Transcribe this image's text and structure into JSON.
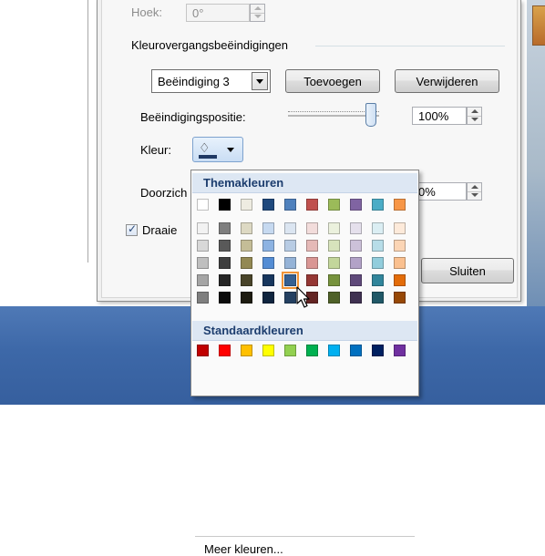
{
  "dialog": {
    "hoek_label": "Hoek:",
    "hoek_value": "0°",
    "section_title": "Kleurovergangsbeëindigingen",
    "stop_select_value": "Beëindiging 3",
    "add_label": "Toevoegen",
    "remove_label": "Verwijderen",
    "position_label": "Beëindigingspositie:",
    "position_value": "100%",
    "position_slider_fraction": 1.0,
    "color_label": "Kleur:",
    "transparency_label_visible": "Doorzich",
    "transparency_value": "0%",
    "rotate_checkbox_label_visible": "Draaie",
    "rotate_checked": true,
    "close_label": "Sluiten"
  },
  "palette": {
    "theme_header": "Themakleuren",
    "standard_header": "Standaardkleuren",
    "more_colors": "Meer kleuren...",
    "theme_columns": [
      [
        "#ffffff",
        "#f2f2f2",
        "#d8d8d8",
        "#bfbfbf",
        "#a5a5a5",
        "#7f7f7f"
      ],
      [
        "#000000",
        "#7f7f7f",
        "#595959",
        "#3f3f3f",
        "#262626",
        "#0c0c0c"
      ],
      [
        "#eeece1",
        "#ddd9c3",
        "#c4bd97",
        "#938953",
        "#494429",
        "#1d1b10"
      ],
      [
        "#1f497d",
        "#c6d9f0",
        "#8db3e2",
        "#548dd4",
        "#17365d",
        "#0f243e"
      ],
      [
        "#4f81bd",
        "#dbe5f1",
        "#b8cce4",
        "#95b3d7",
        "#366092",
        "#244061"
      ],
      [
        "#c0504d",
        "#f2dcdb",
        "#e5b9b7",
        "#d99694",
        "#953734",
        "#632423"
      ],
      [
        "#9bbb59",
        "#ebf1dd",
        "#d7e3bc",
        "#c3d69b",
        "#76923c",
        "#4f6128"
      ],
      [
        "#8064a2",
        "#e5e0ec",
        "#ccc1d9",
        "#b2a2c7",
        "#5f497a",
        "#3f3151"
      ],
      [
        "#4bacc6",
        "#dbeef3",
        "#b7dde8",
        "#92cddc",
        "#31859b",
        "#205867"
      ],
      [
        "#f79646",
        "#fdeada",
        "#fbd5b5",
        "#fac08f",
        "#e36c09",
        "#974806"
      ]
    ],
    "standard_colors": [
      "#c00000",
      "#ff0000",
      "#ffc000",
      "#ffff00",
      "#92d050",
      "#00b050",
      "#00b0f0",
      "#0070c0",
      "#002060",
      "#7030a0"
    ],
    "selected": {
      "column": 4,
      "row": 4
    }
  }
}
